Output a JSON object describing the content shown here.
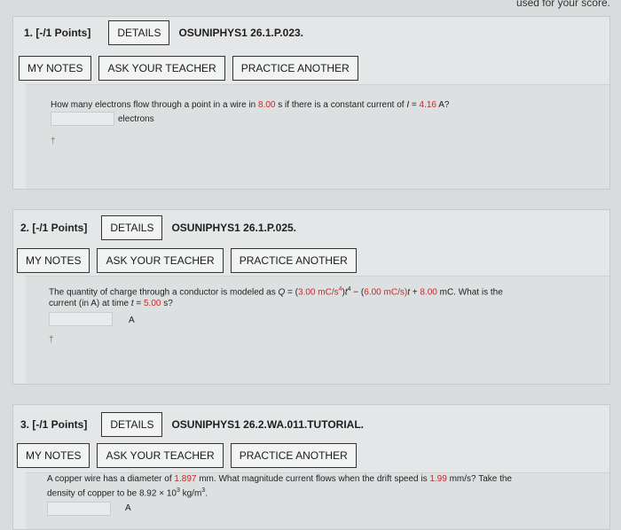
{
  "topnote": "used for your score.",
  "buttons": {
    "my_notes": "MY NOTES",
    "ask": "ASK YOUR TEACHER",
    "practice": "PRACTICE ANOTHER",
    "details": "DETAILS"
  },
  "questions": [
    {
      "points": "1. [-/1 Points]",
      "code": "OSUNIPHYS1 26.1.P.023.",
      "text_parts": [
        "How many electrons flow through a point in a wire in ",
        "8.00",
        " s if there is a constant current of ",
        "I",
        " = ",
        "4.16",
        " A?"
      ],
      "unit": "electrons",
      "dagger": "†"
    },
    {
      "points": "2. [-/1 Points]",
      "code": "OSUNIPHYS1 26.1.P.025.",
      "line1": [
        "The quantity of charge through a conductor is modeled as ",
        "Q",
        " = (",
        "3.00",
        " mC/s",
        "4",
        ")",
        "t",
        "4",
        " − (",
        "6.00",
        " mC/s)",
        "t",
        " + ",
        "8.00",
        " mC. What is the"
      ],
      "line2": [
        "current (in A) at time ",
        "t",
        " = ",
        "5.00",
        " s?"
      ],
      "unit": "A",
      "dagger": "†"
    },
    {
      "points": "3. [-/1 Points]",
      "code": "OSUNIPHYS1 26.2.WA.011.TUTORIAL.",
      "line1": [
        "A copper wire has a diameter of ",
        "1.897",
        " mm. What magnitude current flows when the drift speed is ",
        "1.99",
        " mm/s? Take the"
      ],
      "line2": [
        "density of copper to be 8.92 × 10",
        "3",
        " kg/m",
        "3",
        "."
      ],
      "unit": "A"
    }
  ]
}
